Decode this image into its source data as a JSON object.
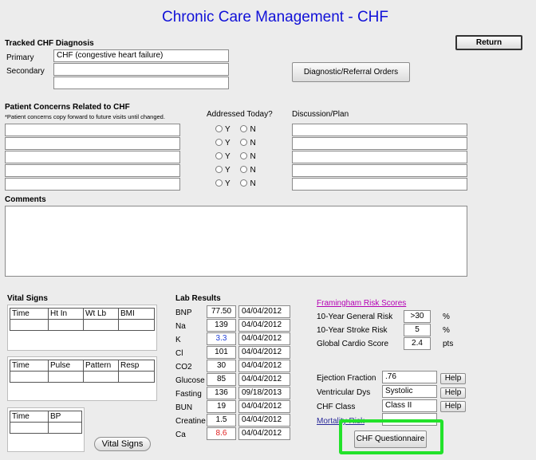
{
  "title": "Chronic Care Management - CHF",
  "return_label": "Return",
  "diagnosis": {
    "heading": "Tracked CHF Diagnosis",
    "primary_label": "Primary",
    "primary_value": "CHF (congestive heart failure)",
    "secondary_label": "Secondary",
    "secondary_value_1": "",
    "secondary_value_2": "",
    "orders_button": "Diagnostic/Referral Orders"
  },
  "concerns": {
    "heading": "Patient Concerns Related to CHF",
    "note": "*Patient concerns copy forward to future visits until changed.",
    "addressed_label": "Addressed Today?",
    "discussion_label": "Discussion/Plan",
    "yes": "Y",
    "no": "N",
    "rows": [
      "",
      "",
      "",
      "",
      ""
    ],
    "plans": [
      "",
      "",
      "",
      "",
      ""
    ]
  },
  "comments": {
    "heading": "Comments",
    "value": ""
  },
  "vitals": {
    "heading": "Vital Signs",
    "table1_headers": [
      "Time",
      "Ht In",
      "Wt Lb",
      "BMI"
    ],
    "table2_headers": [
      "Time",
      "Pulse",
      "Pattern",
      "Resp"
    ],
    "table3_headers": [
      "Time",
      "BP"
    ],
    "button": "Vital Signs"
  },
  "labs": {
    "heading": "Lab Results",
    "items": [
      {
        "name": "BNP",
        "value": "77.50",
        "date": "04/04/2012",
        "color": "#000000"
      },
      {
        "name": "Na",
        "value": "139",
        "date": "04/04/2012",
        "color": "#000000"
      },
      {
        "name": "K",
        "value": "3.3",
        "date": "04/04/2012",
        "color": "#1f3fd8"
      },
      {
        "name": "Cl",
        "value": "101",
        "date": "04/04/2012",
        "color": "#000000"
      },
      {
        "name": "CO2",
        "value": "30",
        "date": "04/04/2012",
        "color": "#000000"
      },
      {
        "name": "Glucose",
        "value": "85",
        "date": "04/04/2012",
        "color": "#000000"
      },
      {
        "name": "Fasting",
        "value": "136",
        "date": "09/18/2013",
        "color": "#000000"
      },
      {
        "name": "BUN",
        "value": "19",
        "date": "04/04/2012",
        "color": "#000000"
      },
      {
        "name": "Creatine",
        "value": "1.5",
        "date": "04/04/2012",
        "color": "#000000"
      },
      {
        "name": "Ca",
        "value": "8.6",
        "date": "04/04/2012",
        "color": "#e02020"
      }
    ]
  },
  "framingham": {
    "link": "Framingham Risk Scores",
    "general_label": "10-Year General Risk",
    "general_value": ">30",
    "general_unit": "%",
    "stroke_label": "10-Year Stroke Risk",
    "stroke_value": "5",
    "stroke_unit": "%",
    "cardio_label": "Global Cardio Score",
    "cardio_value": "2.4",
    "cardio_unit": "pts"
  },
  "chf": {
    "ef_label": "Ejection Fraction",
    "ef_value": ".76",
    "vd_label": "Ventricular Dys",
    "vd_value": "Systolic",
    "class_label": "CHF Class",
    "class_value": "Class II",
    "help": "Help",
    "mortality_link": "Mortality Risk",
    "mortality_value": "",
    "questionnaire_button": "CHF Questionnaire"
  }
}
